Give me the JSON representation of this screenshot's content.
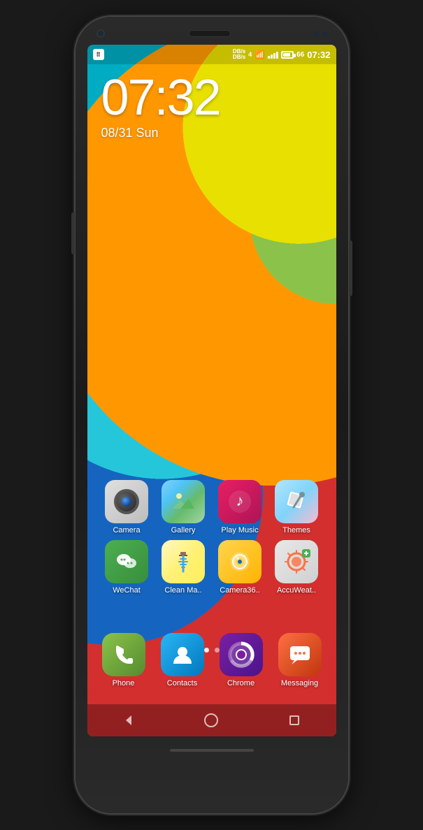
{
  "phone": {
    "status_bar": {
      "time": "07:32",
      "date_full": "Sun 31/08",
      "network_speed": "DB/s\nDB/s",
      "signal": "4",
      "battery_percent": "66"
    },
    "clock": {
      "time": "07:32",
      "date": "08/31  Sun"
    },
    "apps_row1": [
      {
        "id": "camera",
        "label": "Camera",
        "icon_type": "camera"
      },
      {
        "id": "gallery",
        "label": "Gallery",
        "icon_type": "gallery"
      },
      {
        "id": "playmusic",
        "label": "Play Music",
        "icon_type": "playmusic"
      },
      {
        "id": "themes",
        "label": "Themes",
        "icon_type": "themes"
      }
    ],
    "apps_row2": [
      {
        "id": "wechat",
        "label": "WeChat",
        "icon_type": "wechat"
      },
      {
        "id": "cleanmaster",
        "label": "Clean Ma..",
        "icon_type": "cleanmaster"
      },
      {
        "id": "camera360",
        "label": "Camera36..",
        "icon_type": "camera360"
      },
      {
        "id": "accuweather",
        "label": "AccuWeat..",
        "icon_type": "accuweather"
      }
    ],
    "dock": [
      {
        "id": "phone",
        "label": "Phone",
        "icon_type": "phone"
      },
      {
        "id": "contacts",
        "label": "Contacts",
        "icon_type": "contacts"
      },
      {
        "id": "chrome",
        "label": "Chrome",
        "icon_type": "chrome"
      },
      {
        "id": "messaging",
        "label": "Messaging",
        "icon_type": "messaging"
      }
    ],
    "page_dots": [
      {
        "active": false
      },
      {
        "active": true
      },
      {
        "active": false
      },
      {
        "active": false
      }
    ],
    "nav": {
      "back": "◁",
      "home": "○",
      "recents": "□"
    }
  }
}
